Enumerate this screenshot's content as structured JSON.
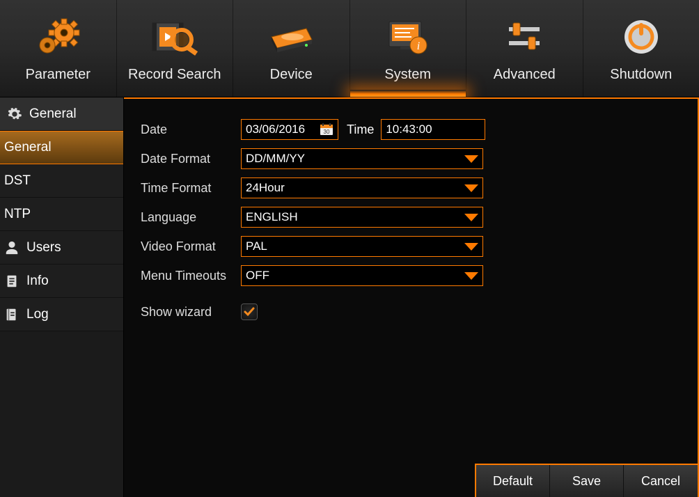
{
  "topnav": {
    "items": [
      {
        "label": "Parameter"
      },
      {
        "label": "Record Search"
      },
      {
        "label": "Device"
      },
      {
        "label": "System"
      },
      {
        "label": "Advanced"
      },
      {
        "label": "Shutdown"
      }
    ]
  },
  "sidebar": {
    "header": "General",
    "items": [
      {
        "label": "General"
      },
      {
        "label": "DST"
      },
      {
        "label": "NTP"
      },
      {
        "label": "Users"
      },
      {
        "label": "Info"
      },
      {
        "label": "Log"
      }
    ]
  },
  "form": {
    "date_label": "Date",
    "date_value": "03/06/2016",
    "time_label": "Time",
    "time_value": "10:43:00",
    "date_format_label": "Date Format",
    "date_format_value": "DD/MM/YY",
    "time_format_label": "Time Format",
    "time_format_value": "24Hour",
    "language_label": "Language",
    "language_value": "ENGLISH",
    "video_format_label": "Video Format",
    "video_format_value": "PAL",
    "menu_timeouts_label": "Menu Timeouts",
    "menu_timeouts_value": "OFF",
    "show_wizard_label": "Show wizard",
    "show_wizard_checked": true
  },
  "footer": {
    "default_label": "Default",
    "save_label": "Save",
    "cancel_label": "Cancel"
  }
}
